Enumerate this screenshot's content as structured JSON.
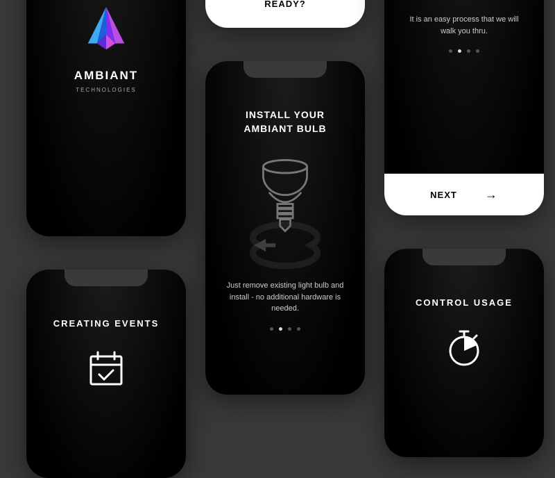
{
  "brand": {
    "name": "AMBIANT",
    "subtitle": "TECHNOLOGIES"
  },
  "ready": {
    "label": "READY?"
  },
  "install": {
    "title_line1": "INSTALL YOUR",
    "title_line2": "AMBIANT BULB",
    "description": "Just remove existing light bulb and install - no additional hardware is needed.",
    "active_dot": 1,
    "total_dots": 4
  },
  "color": {
    "description": "It is an easy process that we will walk you thru.",
    "active_dot": 1,
    "total_dots": 4,
    "next_label": "NEXT"
  },
  "events": {
    "title": "CREATING EVENTS"
  },
  "usage": {
    "title": "CONTROL  USAGE"
  }
}
